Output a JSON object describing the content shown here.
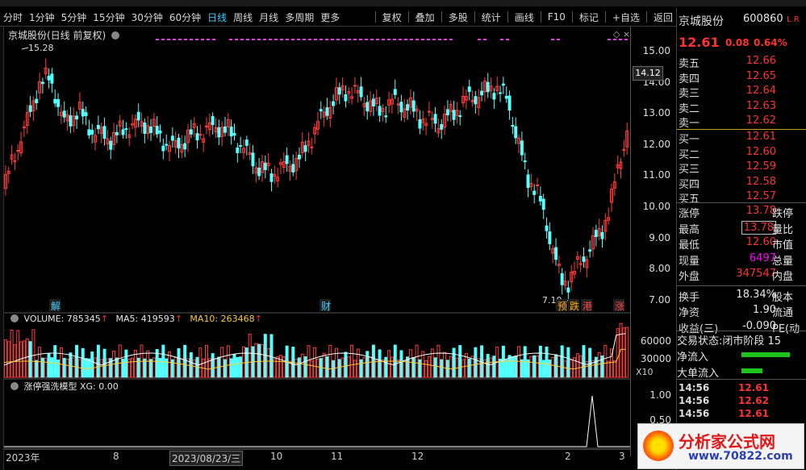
{
  "toolbar": {
    "periods": [
      "分时",
      "1分钟",
      "5分钟",
      "15分钟",
      "30分钟",
      "60分钟",
      "日线",
      "周线",
      "月线",
      "多周期",
      "更多"
    ],
    "selected_period": "日线",
    "actions": [
      "复权",
      "叠加",
      "多股",
      "统计",
      "画线",
      "F10",
      "标记",
      "+自选",
      "返回"
    ]
  },
  "kline": {
    "title": "京城股份(日线 前复权)",
    "y_ticks": [
      "15.00",
      "14.00",
      "13.00",
      "12.00",
      "11.00",
      "10.00",
      "9.00",
      "8.00",
      "7.00"
    ],
    "high_label": "15.28",
    "low_label": "7.10",
    "cursor_price": "14.12",
    "event_markers": [
      "解",
      "财",
      "预",
      "跌",
      "港",
      "涨"
    ]
  },
  "volume": {
    "label": "VOLUME: 785345",
    "ma5": "MA5: 419593",
    "ma10": "MA10: 263468",
    "y_ticks": [
      "60000",
      "30000"
    ],
    "unit": "X10"
  },
  "indicator": {
    "label": "涨停强洗模型 XG: 0.00",
    "y_ticks": [
      "1.00",
      "0.50"
    ]
  },
  "date_axis": {
    "labels": [
      "2023年",
      "8",
      "2023/08/23/三",
      "10",
      "11",
      "12",
      "2",
      "3"
    ]
  },
  "stock": {
    "name": "京城股份",
    "code": "600860",
    "badge": "L R",
    "price": "12.61",
    "change": "0.08",
    "change_pct": "0.64%"
  },
  "order_book": {
    "asks": [
      {
        "label": "卖五",
        "price": "12.66"
      },
      {
        "label": "卖四",
        "price": "12.65"
      },
      {
        "label": "卖三",
        "price": "12.64"
      },
      {
        "label": "卖二",
        "price": "12.63"
      },
      {
        "label": "卖一",
        "price": "12.62"
      }
    ],
    "bids": [
      {
        "label": "买一",
        "price": "12.61"
      },
      {
        "label": "买二",
        "price": "12.60"
      },
      {
        "label": "买三",
        "price": "12.59"
      },
      {
        "label": "买四",
        "price": "12.58"
      },
      {
        "label": "买五",
        "price": "12.57"
      }
    ]
  },
  "quote": {
    "limit_up": {
      "label": "涨停",
      "value": "13.78",
      "right": "跌停"
    },
    "high": {
      "label": "最高",
      "value": "13.78",
      "right": "量比"
    },
    "low": {
      "label": "最低",
      "value": "12.60",
      "right": "市值"
    },
    "volume_now": {
      "label": "现量",
      "value": "6497",
      "right": "总量"
    },
    "outer": {
      "label": "外盘",
      "value": "347547",
      "right": "内盘"
    },
    "turnover": {
      "label": "换手",
      "value": "18.34%",
      "right": "股本"
    },
    "net_asset": {
      "label": "净资",
      "value": "1.90",
      "right": "流通"
    },
    "earnings": {
      "label": "收益(三)",
      "value": "-0.090",
      "right": "PE(动"
    }
  },
  "status": {
    "trade_state_label": "交易状态:",
    "trade_state_value": "闭市阶段 15",
    "net_inflow": "净流入",
    "big_inflow": "大单流入"
  },
  "ticks": [
    {
      "time": "14:56",
      "price": "12.61"
    },
    {
      "time": "14:56",
      "price": "12.62"
    },
    {
      "time": "14:56",
      "price": "12.61"
    }
  ],
  "watermark": {
    "brand": "分析家公式网",
    "url": "www.70822.com"
  }
}
